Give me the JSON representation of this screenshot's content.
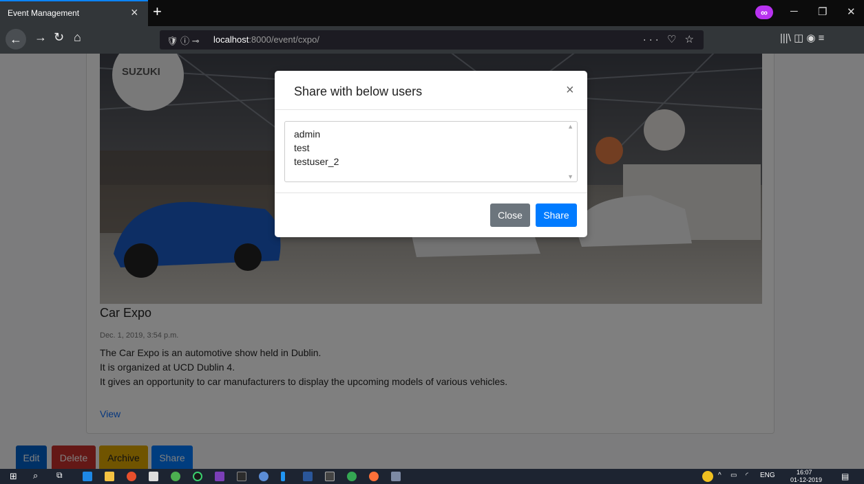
{
  "browser": {
    "tab_title": "Event Management",
    "tab_close": "×",
    "new_tab": "+",
    "url_host": "localhost",
    "url_path": ":8000/event/cxpo/",
    "url_icons": "🛡  ⓘ ⊸",
    "url_actions": "··· ♡ ☆",
    "nav_right": "|||\\ ◫ ◉ ≡"
  },
  "event": {
    "title": "Car Expo",
    "date": "Dec. 1, 2019, 3:54 p.m.",
    "description_lines": [
      "The Car Expo is an automotive show held in Dublin.",
      "It is organized at UCD Dublin 4.",
      "It gives an opportunity to car manufacturers to display the upcoming models of various vehicles."
    ],
    "view_label": "View",
    "image_text": "SUZUKI"
  },
  "actions": {
    "edit": "Edit",
    "delete": "Delete",
    "archive": "Archive",
    "share": "Share"
  },
  "modal": {
    "title": "Share with below users",
    "close_x": "×",
    "users": [
      "admin",
      "test",
      "testuser_2"
    ],
    "close_button": "Close",
    "share_button": "Share"
  },
  "taskbar": {
    "lang": "ENG",
    "time": "16:07",
    "date": "01-12-2019"
  },
  "colors": {
    "primary": "#007bff",
    "danger": "#c9302c",
    "warning": "#e0a800",
    "secondary": "#6c757d"
  }
}
